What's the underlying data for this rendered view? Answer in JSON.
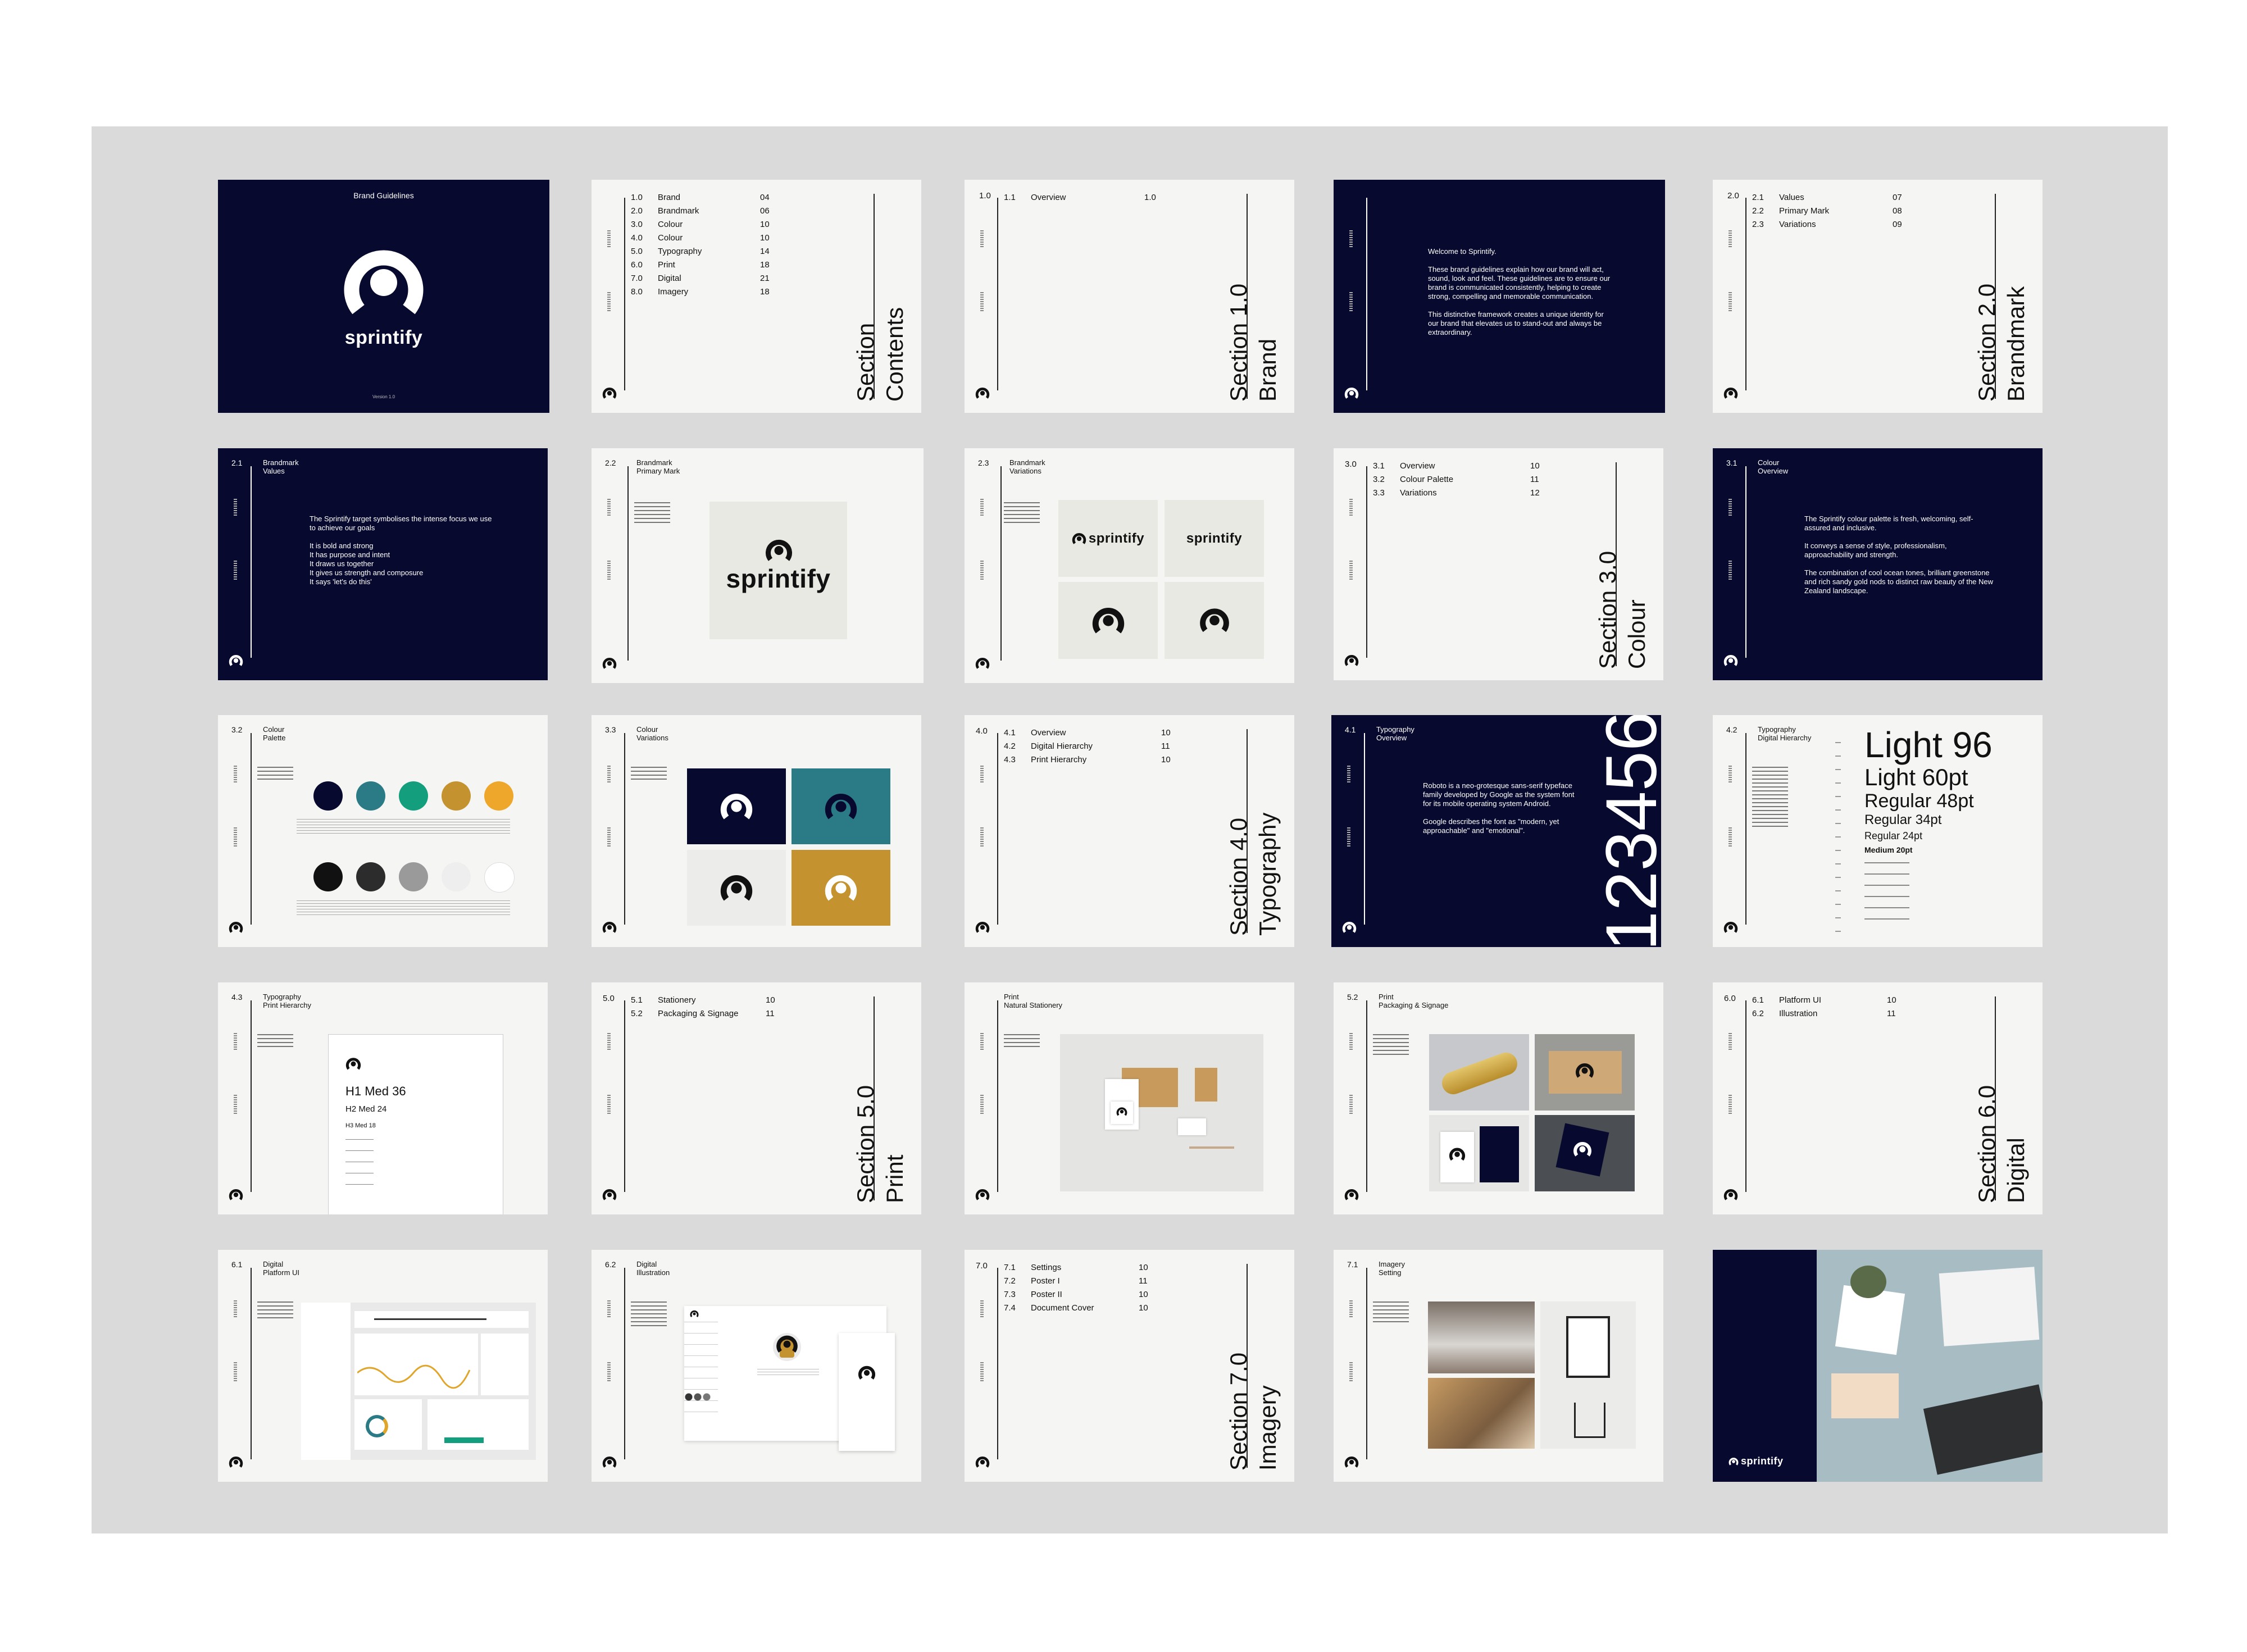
{
  "colors": {
    "navy": "#070a2e",
    "teal": "#2b7b86",
    "green": "#139e7e",
    "gold": "#c4922e",
    "orange": "#eea62b",
    "black": "#111111",
    "charcoal": "#2c2c2c",
    "grey": "#9a9a9a",
    "light": "#eeeeee",
    "white": "#ffffff"
  },
  "cover": {
    "title": "Brand Guidelines",
    "wordmark": "sprintify",
    "version": "Version 1.0"
  },
  "contents": {
    "rows": [
      {
        "n": "1.0",
        "t": "Brand",
        "p": "04"
      },
      {
        "n": "2.0",
        "t": "Brandmark",
        "p": "06"
      },
      {
        "n": "3.0",
        "t": "Colour",
        "p": "10"
      },
      {
        "n": "4.0",
        "t": "Colour",
        "p": "10"
      },
      {
        "n": "5.0",
        "t": "Typography",
        "p": "14"
      },
      {
        "n": "6.0",
        "t": "Print",
        "p": "18"
      },
      {
        "n": "7.0",
        "t": "Digital",
        "p": "21"
      },
      {
        "n": "8.0",
        "t": "Imagery",
        "p": "18"
      }
    ],
    "s1": "Section",
    "s2": "Contents"
  },
  "sec1": {
    "num": "1.0",
    "rows": [
      {
        "n": "1.1",
        "t": "Overview",
        "p": "1.0"
      }
    ],
    "s1": "Section 1.0",
    "s2": "Brand"
  },
  "welcome": {
    "p1": "Welcome to Sprintify.",
    "p2": "These brand guidelines explain how our brand will act, sound, look and feel. These guidelines are to ensure our brand is communicated consistently, helping to create strong, compelling and memorable communication.",
    "p3": "This distinctive framework creates a unique identity for our brand that elevates us to stand-out and always be extraordinary."
  },
  "sec2": {
    "num": "2.0",
    "rows": [
      {
        "n": "2.1",
        "t": "Values",
        "p": "07"
      },
      {
        "n": "2.2",
        "t": "Primary Mark",
        "p": "08"
      },
      {
        "n": "2.3",
        "t": "Variations",
        "p": "09"
      }
    ],
    "s1": "Section 2.0",
    "s2": "Brandmark"
  },
  "values": {
    "num": "2.1",
    "h1": "Brandmark",
    "h2": "Values",
    "p1": "The Sprintify target symbolises the intense focus we use to achieve our goals",
    "lines": [
      "It is bold and strong",
      "It has purpose and intent",
      "It draws us together",
      "It gives us strength and composure",
      "It says 'let's do this'"
    ]
  },
  "primary": {
    "num": "2.2",
    "h1": "Brandmark",
    "h2": "Primary Mark",
    "wordmark": "sprintify"
  },
  "variations": {
    "num": "2.3",
    "h1": "Brandmark",
    "h2": "Variations",
    "wordmark": "sprintify"
  },
  "sec3": {
    "num": "3.0",
    "rows": [
      {
        "n": "3.1",
        "t": "Overview",
        "p": "10"
      },
      {
        "n": "3.2",
        "t": "Colour Palette",
        "p": "11"
      },
      {
        "n": "3.3",
        "t": "Variations",
        "p": "12"
      }
    ],
    "s1": "Section 3.0",
    "s2": "Colour"
  },
  "colour_ov": {
    "num": "3.1",
    "h1": "Colour",
    "h2": "Overview",
    "p1": "The Sprintify colour palette is fresh, welcoming, self-assured and inclusive.",
    "p2": "It conveys a sense of style, professionalism, approachability and strength.",
    "p3": "The combination of cool ocean tones, brilliant greenstone and rich sandy gold nods to distinct raw beauty of the New Zealand landscape."
  },
  "palette": {
    "num": "3.2",
    "h1": "Colour",
    "h2": "Palette"
  },
  "col_var": {
    "num": "3.3",
    "h1": "Colour",
    "h2": "Variations"
  },
  "sec4": {
    "num": "4.0",
    "rows": [
      {
        "n": "4.1",
        "t": "Overview",
        "p": "10"
      },
      {
        "n": "4.2",
        "t": "Digital Hierarchy",
        "p": "11"
      },
      {
        "n": "4.3",
        "t": "Print Hierarchy",
        "p": "10"
      }
    ],
    "s1": "Section 4.0",
    "s2": "Typography"
  },
  "typo_ov": {
    "num": "4.1",
    "h1": "Typography",
    "h2": "Overview",
    "p1": "Roboto is a neo-grotesque sans-serif typeface family developed by Google as the system font for its mobile operating system Android.",
    "p2": "Google describes the font as \"modern, yet approachable\" and \"emotional\".",
    "digits": "123456"
  },
  "digital_h": {
    "num": "4.2",
    "h1": "Typography",
    "h2": "Digital Hierarchy",
    "sizes": [
      "Light 96",
      "Light 60pt",
      "Regular 48pt",
      "Regular 34pt",
      "Regular 24pt",
      "Medium 20pt"
    ]
  },
  "print_h": {
    "num": "4.3",
    "h1": "Typography",
    "h2": "Print Hierarchy",
    "lines": [
      "H1 Med 36",
      "H2 Med 24",
      "H3 Med 18"
    ]
  },
  "sec5": {
    "num": "5.0",
    "rows": [
      {
        "n": "5.1",
        "t": "Stationery",
        "p": "10"
      },
      {
        "n": "5.2",
        "t": "Packaging & Signage",
        "p": "11"
      }
    ],
    "s1": "Section 5.0",
    "s2": "Print"
  },
  "stationery": {
    "h1": "Print",
    "h2": "Natural Stationery"
  },
  "packaging": {
    "num": "5.2",
    "h1": "Print",
    "h2": "Packaging & Signage"
  },
  "sec6": {
    "num": "6.0",
    "rows": [
      {
        "n": "6.1",
        "t": "Platform UI",
        "p": "10"
      },
      {
        "n": "6.2",
        "t": "Illustration",
        "p": "11"
      }
    ],
    "s1": "Section 6.0",
    "s2": "Digital"
  },
  "platform": {
    "num": "6.1",
    "h1": "Digital",
    "h2": "Platform UI"
  },
  "illus": {
    "num": "6.2",
    "h1": "Digital",
    "h2": "Illustration"
  },
  "sec7": {
    "num": "7.0",
    "rows": [
      {
        "n": "7.1",
        "t": "Settings",
        "p": "10"
      },
      {
        "n": "7.2",
        "t": "Poster I",
        "p": "11"
      },
      {
        "n": "7.3",
        "t": "Poster II",
        "p": "10"
      },
      {
        "n": "7.4",
        "t": "Document Cover",
        "p": "10"
      }
    ],
    "s1": "Section 7.0",
    "s2": "Imagery"
  },
  "imagery": {
    "num": "7.1",
    "h1": "Imagery",
    "h2": "Setting"
  },
  "final": {
    "wordmark": "sprintify"
  }
}
